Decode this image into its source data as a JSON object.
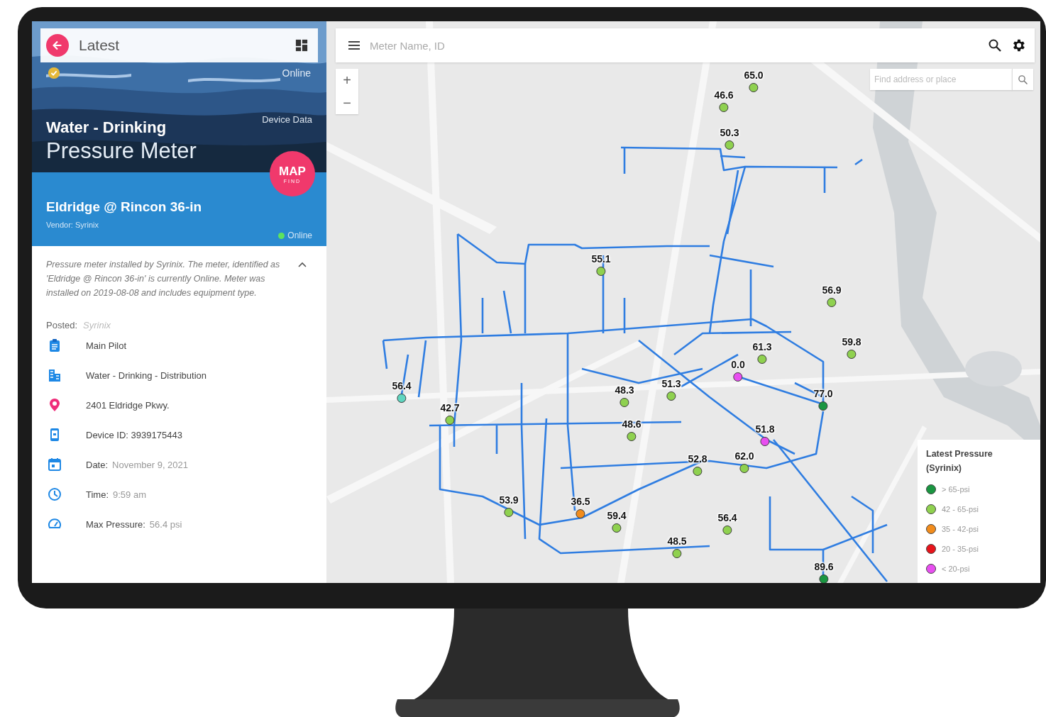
{
  "header": {
    "title": "Latest"
  },
  "hero": {
    "status": "Online",
    "section_label": "Device Data",
    "category": "Water - Drinking",
    "type": "Pressure Meter",
    "map_button": {
      "main": "MAP",
      "sub": "FIND"
    }
  },
  "meter": {
    "name": "Eldridge @ Rincon 36-in",
    "vendor": "Vendor: Syrinix",
    "status": "Online",
    "online": true
  },
  "description": {
    "text": "Pressure meter installed by Syrinix. The meter, identified as 'Eldridge @ Rincon 36-in' is currently Online. Meter was installed on 2019-08-08 and includes equipment type.",
    "expanded": true
  },
  "posted": {
    "label": "Posted:",
    "value": "Syrinix"
  },
  "details": [
    {
      "kind": "clipboard",
      "value": "Main Pilot"
    },
    {
      "kind": "building",
      "value": "Water - Drinking - Distribution"
    },
    {
      "kind": "pin",
      "value": "2401 Eldridge Pkwy."
    },
    {
      "kind": "device",
      "value": "Device ID: 3939175443"
    },
    {
      "kind": "calendar",
      "label": "Date:",
      "value": "November 9, 2021"
    },
    {
      "kind": "clock",
      "label": "Time:",
      "value": "9:59 am"
    },
    {
      "kind": "gauge",
      "label": "Max Pressure:",
      "value": "56.4 psi"
    }
  ],
  "map": {
    "search_placeholder": "Meter Name, ID",
    "address_placeholder": "Find address or place",
    "zoom_in": "+",
    "zoom_out": "−",
    "markers": [
      {
        "value": "65.0",
        "color": "#8fd14f"
      },
      {
        "value": "46.6",
        "color": "#8fd14f"
      },
      {
        "value": "50.3",
        "color": "#8fd14f"
      },
      {
        "value": "55.1",
        "color": "#8fd14f"
      },
      {
        "value": "56.9",
        "color": "#8fd14f"
      },
      {
        "value": "59.8",
        "color": "#8fd14f"
      },
      {
        "value": "61.3",
        "color": "#8fd14f"
      },
      {
        "value": "0.0",
        "color": "#e84ef0"
      },
      {
        "value": "77.0",
        "color": "#1a9641"
      },
      {
        "value": "56.4",
        "color": "#5fd6c0"
      },
      {
        "value": "42.7",
        "color": "#8fd14f"
      },
      {
        "value": "48.3",
        "color": "#8fd14f"
      },
      {
        "value": "51.3",
        "color": "#8fd14f"
      },
      {
        "value": "48.6",
        "color": "#8fd14f"
      },
      {
        "value": "51.8",
        "color": "#e84ef0"
      },
      {
        "value": "52.8",
        "color": "#8fd14f"
      },
      {
        "value": "62.0",
        "color": "#8fd14f"
      },
      {
        "value": "53.9",
        "color": "#8fd14f"
      },
      {
        "value": "36.5",
        "color": "#f28c1c"
      },
      {
        "value": "59.4",
        "color": "#8fd14f"
      },
      {
        "value": "56.4",
        "color": "#8fd14f"
      },
      {
        "value": "48.5",
        "color": "#8fd14f"
      },
      {
        "value": "89.6",
        "color": "#1a9641"
      }
    ],
    "legend": {
      "title": "Latest Pressure (Syrinix)",
      "items": [
        {
          "label": "> 65-psi",
          "color": "#1a9641"
        },
        {
          "label": "42 - 65-psi",
          "color": "#8fd14f"
        },
        {
          "label": "35 - 42-psi",
          "color": "#f28c1c"
        },
        {
          "label": "20 - 35-psi",
          "color": "#e8141b"
        },
        {
          "label": "< 20-psi",
          "color": "#e84ef0"
        }
      ]
    }
  }
}
